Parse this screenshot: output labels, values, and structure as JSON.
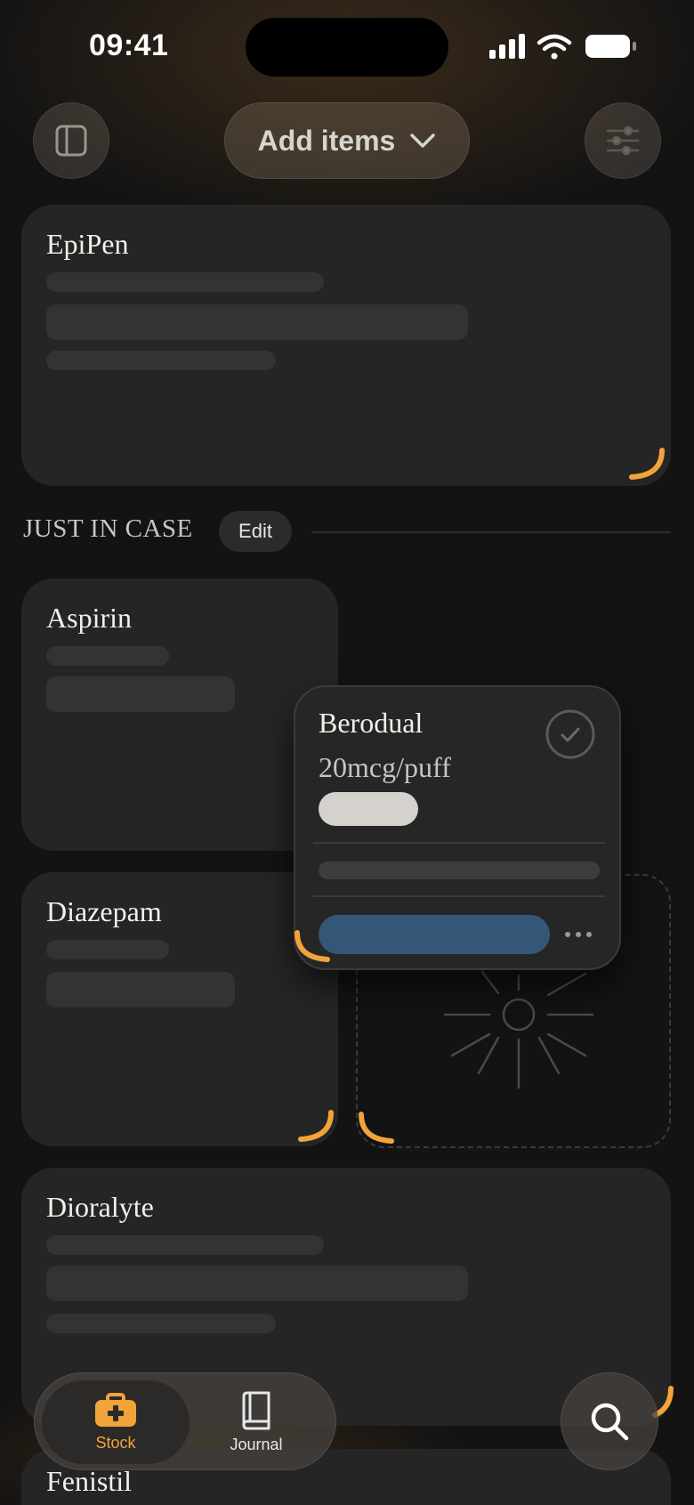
{
  "status_bar": {
    "time": "09:41"
  },
  "header": {
    "add_items_label": "Add items"
  },
  "cards": {
    "epipen": "EpiPen",
    "aspirin": "Aspirin",
    "diazepam": "Diazepam",
    "dioralyte": "Dioralyte",
    "fenistil": "Fenistil"
  },
  "section": {
    "title": "JUST IN CASE",
    "edit_label": "Edit"
  },
  "popup": {
    "name": "Berodual",
    "dose": "20mcg/puff"
  },
  "tabs": [
    {
      "label": "Stock",
      "icon": "first-aid-kit-icon",
      "active": true
    },
    {
      "label": "Journal",
      "icon": "book-icon",
      "active": false
    }
  ],
  "colors": {
    "accent_orange": "#F2A33A",
    "action_blue": "#345777",
    "card_bg": "#252525",
    "background": "#131313"
  }
}
